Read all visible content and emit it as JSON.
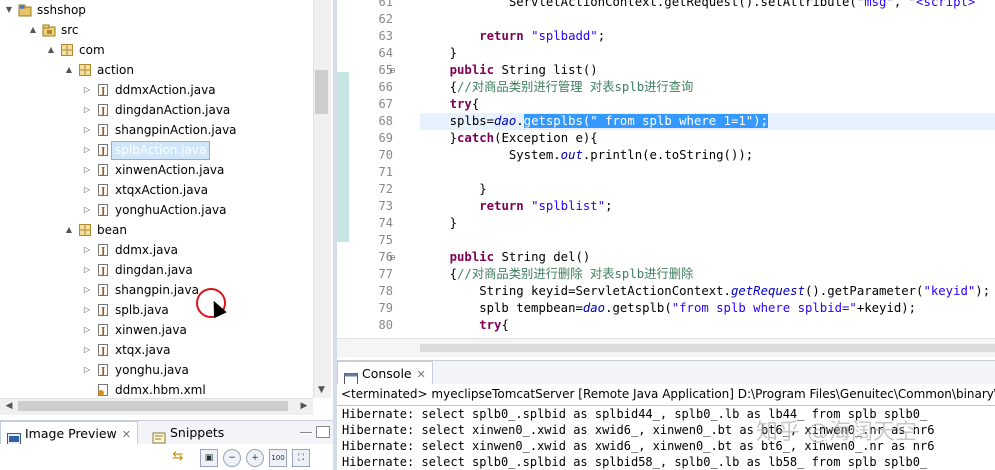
{
  "package_explorer": {
    "items": [
      {
        "label": "sshshop",
        "icon": "project-icon",
        "twisty": "▼",
        "depth": 0
      },
      {
        "label": "src",
        "icon": "source-folder-icon",
        "twisty": "▲",
        "depth": 1
      },
      {
        "label": "com",
        "icon": "package-icon",
        "twisty": "▲",
        "depth": 2
      },
      {
        "label": "action",
        "icon": "package-icon",
        "twisty": "▲",
        "depth": 3
      },
      {
        "label": "ddmxAction.java",
        "icon": "java-file-icon",
        "twisty": "▷",
        "depth": 4
      },
      {
        "label": "dingdanAction.java",
        "icon": "java-file-icon",
        "twisty": "▷",
        "depth": 4
      },
      {
        "label": "shangpinAction.java",
        "icon": "java-file-icon",
        "twisty": "▷",
        "depth": 4
      },
      {
        "label": "splbAction.java",
        "icon": "java-file-icon",
        "twisty": "▷",
        "depth": 4,
        "selected": true
      },
      {
        "label": "xinwenAction.java",
        "icon": "java-file-icon",
        "twisty": "▷",
        "depth": 4
      },
      {
        "label": "xtqxAction.java",
        "icon": "java-file-icon",
        "twisty": "▷",
        "depth": 4
      },
      {
        "label": "yonghuAction.java",
        "icon": "java-file-icon",
        "twisty": "▷",
        "depth": 4
      },
      {
        "label": "bean",
        "icon": "package-icon",
        "twisty": "▲",
        "depth": 3
      },
      {
        "label": "ddmx.java",
        "icon": "java-file-icon",
        "twisty": "▷",
        "depth": 4
      },
      {
        "label": "dingdan.java",
        "icon": "java-file-icon",
        "twisty": "▷",
        "depth": 4
      },
      {
        "label": "shangpin.java",
        "icon": "java-file-icon",
        "twisty": "▷",
        "depth": 4
      },
      {
        "label": "splb.java",
        "icon": "java-file-icon",
        "twisty": "▷",
        "depth": 4
      },
      {
        "label": "xinwen.java",
        "icon": "java-file-icon",
        "twisty": "▷",
        "depth": 4
      },
      {
        "label": "xtqx.java",
        "icon": "java-file-icon",
        "twisty": "▷",
        "depth": 4
      },
      {
        "label": "yonghu.java",
        "icon": "java-file-icon",
        "twisty": "▷",
        "depth": 4
      },
      {
        "label": "ddmx.hbm.xml",
        "icon": "xml-file-icon",
        "twisty": "",
        "depth": 4
      }
    ]
  },
  "image_preview": {
    "tabs": [
      {
        "label": "Image Preview",
        "icon": "image-preview-icon",
        "active": true
      },
      {
        "label": "Snippets",
        "icon": "snippets-icon",
        "active": false
      }
    ],
    "toolbar_buttons": [
      "sync-icon",
      "fit-image-icon",
      "zoom-out-icon",
      "zoom-in-icon",
      "actual-size-icon",
      "fit-window-icon"
    ],
    "toolbar_glyphs": [
      "⇆",
      "▣",
      "−",
      "+",
      "100",
      "⛶"
    ]
  },
  "editor": {
    "lines": [
      {
        "n": "61",
        "fold": "",
        "code": "            ServletActionContext.getRequest().setAttribute(\"msg\", \"<script>",
        "parts": [
          [
            "            ServletActionContext.getRequest().setAttribute(",
            ""
          ],
          [
            "\"msg\"",
            "str"
          ],
          [
            ", ",
            ""
          ],
          [
            "\"<script>",
            "str"
          ]
        ]
      },
      {
        "n": "62",
        "fold": "",
        "parts": []
      },
      {
        "n": "63",
        "fold": "",
        "parts": [
          [
            "        ",
            ""
          ],
          [
            "return",
            "kw"
          ],
          [
            " ",
            ""
          ],
          [
            "\"splbadd\"",
            "str"
          ],
          [
            ";",
            ""
          ]
        ]
      },
      {
        "n": "64",
        "fold": "",
        "parts": [
          [
            "    }",
            ""
          ]
        ]
      },
      {
        "n": "65",
        "fold": "⊖",
        "parts": [
          [
            "    ",
            ""
          ],
          [
            "public",
            "kw"
          ],
          [
            " String list()",
            ""
          ]
        ]
      },
      {
        "n": "66",
        "fold": "",
        "parts": [
          [
            "    {",
            ""
          ],
          [
            "//对商品类别进行管理 对表splb进行查询",
            "cmt"
          ]
        ]
      },
      {
        "n": "67",
        "fold": "",
        "parts": [
          [
            "    ",
            ""
          ],
          [
            "try",
            "kw"
          ],
          [
            "{",
            ""
          ]
        ]
      },
      {
        "n": "68",
        "fold": "",
        "current": true,
        "parts": [
          [
            "    splbs=",
            ""
          ],
          [
            "dao",
            "it"
          ],
          [
            ".",
            ""
          ],
          [
            "getsplbs(\" from splb where 1=1\");",
            "sel"
          ]
        ]
      },
      {
        "n": "69",
        "fold": "",
        "parts": [
          [
            "    }",
            ""
          ],
          [
            "catch",
            "kw"
          ],
          [
            "(Exception e){",
            ""
          ]
        ]
      },
      {
        "n": "70",
        "fold": "",
        "parts": [
          [
            "            System.",
            ""
          ],
          [
            "out",
            "it"
          ],
          [
            ".println(e.toString());",
            ""
          ]
        ]
      },
      {
        "n": "71",
        "fold": "",
        "parts": []
      },
      {
        "n": "72",
        "fold": "",
        "parts": [
          [
            "        }",
            ""
          ]
        ]
      },
      {
        "n": "73",
        "fold": "",
        "parts": [
          [
            "        ",
            ""
          ],
          [
            "return",
            "kw"
          ],
          [
            " ",
            ""
          ],
          [
            "\"splblist\"",
            "str"
          ],
          [
            ";",
            ""
          ]
        ]
      },
      {
        "n": "74",
        "fold": "",
        "parts": [
          [
            "    }",
            ""
          ]
        ]
      },
      {
        "n": "75",
        "fold": "",
        "parts": []
      },
      {
        "n": "76",
        "fold": "⊖",
        "parts": [
          [
            "    ",
            ""
          ],
          [
            "public",
            "kw"
          ],
          [
            " String del()",
            ""
          ]
        ]
      },
      {
        "n": "77",
        "fold": "",
        "parts": [
          [
            "    {",
            ""
          ],
          [
            "//对商品类别进行删除 对表splb进行删除",
            "cmt"
          ]
        ]
      },
      {
        "n": "78",
        "fold": "",
        "parts": [
          [
            "        String keyid=ServletActionContext.",
            ""
          ],
          [
            "getRequest",
            "it"
          ],
          [
            "().getParameter(",
            ""
          ],
          [
            "\"keyid\"",
            "str"
          ],
          [
            ");",
            ""
          ]
        ]
      },
      {
        "n": "79",
        "fold": "",
        "parts": [
          [
            "        splb tempbean=",
            ""
          ],
          [
            "dao",
            "it"
          ],
          [
            ".getsplb(",
            ""
          ],
          [
            "\"from splb where splbid=\"",
            "str"
          ],
          [
            "+keyid);",
            ""
          ]
        ]
      },
      {
        "n": "80",
        "fold": "",
        "parts": [
          [
            "        ",
            ""
          ],
          [
            "try",
            "kw"
          ],
          [
            "{",
            ""
          ]
        ]
      }
    ]
  },
  "console": {
    "tab_label": "Console",
    "status": "<terminated> myeclipseTomcatServer [Remote Java Application] D:\\Program Files\\Genuitec\\Common\\binary\\com",
    "lines": [
      "Hibernate: select splb0_.splbid as splbid44_, splb0_.lb as lb44_ from splb splb0_",
      "Hibernate: select xinwen0_.xwid as xwid6_, xinwen0_.bt as bt6_, xinwen0_.nr as nr6",
      "Hibernate: select xinwen0_.xwid as xwid6_, xinwen0_.bt as bt6_, xinwen0_.nr as nr6",
      "Hibernate: select splb0_.splbid as splbid58_, splb0_.lb as lb58_ from splb splb0_"
    ]
  },
  "watermark": "知乎 @海阔天空",
  "colors": {
    "keyword": "#7f0055",
    "string": "#2a00ff",
    "comment": "#3f7f5f",
    "selection": "#3399ff"
  }
}
